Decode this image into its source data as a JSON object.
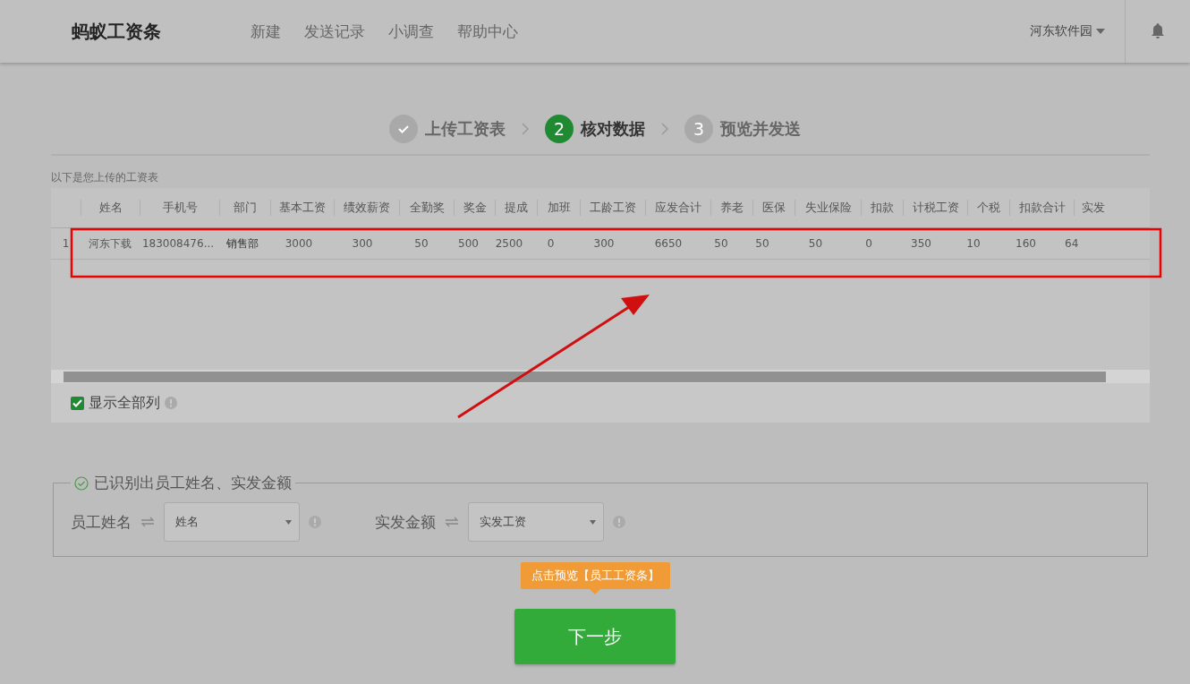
{
  "header": {
    "logo": "蚂蚁工资条",
    "nav": [
      {
        "label": "新建"
      },
      {
        "label": "发送记录"
      },
      {
        "label": "小调查"
      },
      {
        "label": "帮助中心"
      }
    ],
    "user": "河东软件园"
  },
  "steps": [
    {
      "label": "上传工资表",
      "completed": true,
      "selected": false
    },
    {
      "number": "2",
      "label": "核对数据",
      "completed": false,
      "selected": true
    },
    {
      "number": "3",
      "label": "预览并发送",
      "completed": false,
      "selected": false
    }
  ],
  "table": {
    "caption": "以下是您上传的工资表",
    "columns": [
      "",
      "姓名",
      "手机号",
      "部门",
      "基本工资",
      "绩效薪资",
      "全勤奖",
      "奖金",
      "提成",
      "加班",
      "工龄工资",
      "应发合计",
      "养老",
      "医保",
      "失业保险",
      "扣款",
      "计税工资",
      "个税",
      "扣款合计",
      "实发"
    ],
    "rows": [
      [
        "1",
        "河东下载",
        "183008476...",
        "销售部",
        "3000",
        "300",
        "50",
        "500",
        "2500",
        "0",
        "300",
        "6650",
        "50",
        "50",
        "50",
        "0",
        "350",
        "10",
        "160",
        "64"
      ]
    ]
  },
  "show_all_columns": {
    "label": "显示全部列",
    "checked": true
  },
  "mapping": {
    "title": "已识别出员工姓名、实发金额",
    "fields": [
      {
        "label": "员工姓名",
        "value": "姓名"
      },
      {
        "label": "实发金额",
        "value": "实发工资"
      }
    ]
  },
  "tooltip": "点击预览【员工工资条】",
  "next_button": "下一步"
}
